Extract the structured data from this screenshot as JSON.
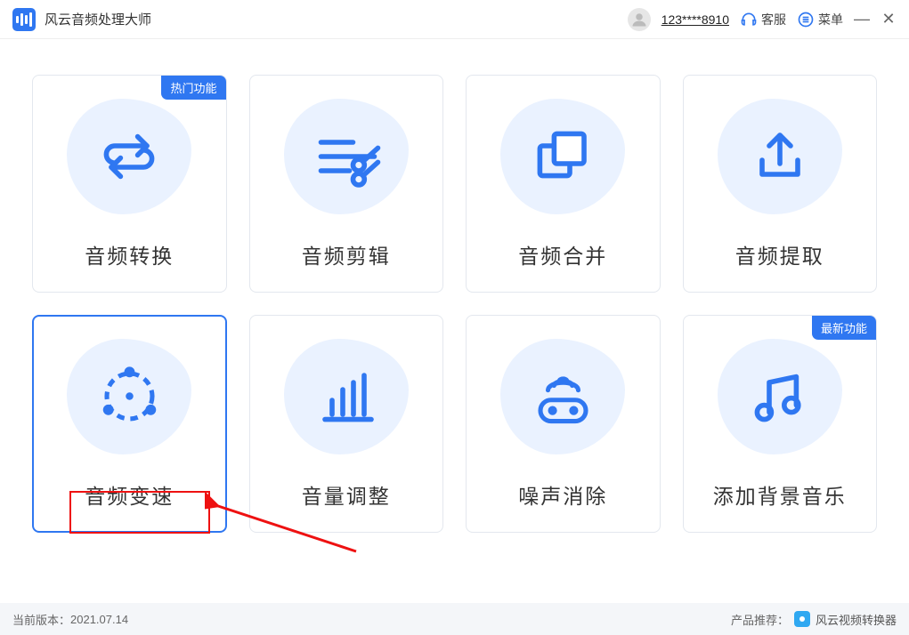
{
  "header": {
    "app_title": "风云音频处理大师",
    "user_phone": "123****8910",
    "support_label": "客服",
    "menu_label": "菜单"
  },
  "badges": {
    "hot": "热门功能",
    "new": "最新功能"
  },
  "cards": [
    {
      "label": "音频转换"
    },
    {
      "label": "音频剪辑"
    },
    {
      "label": "音频合并"
    },
    {
      "label": "音频提取"
    },
    {
      "label": "音频变速"
    },
    {
      "label": "音量调整"
    },
    {
      "label": "噪声消除"
    },
    {
      "label": "添加背景音乐"
    }
  ],
  "footer": {
    "version_prefix": "当前版本：",
    "version": "2021.07.14",
    "recommend_prefix": "产品推荐：",
    "recommend_name": "风云视频转换器"
  }
}
